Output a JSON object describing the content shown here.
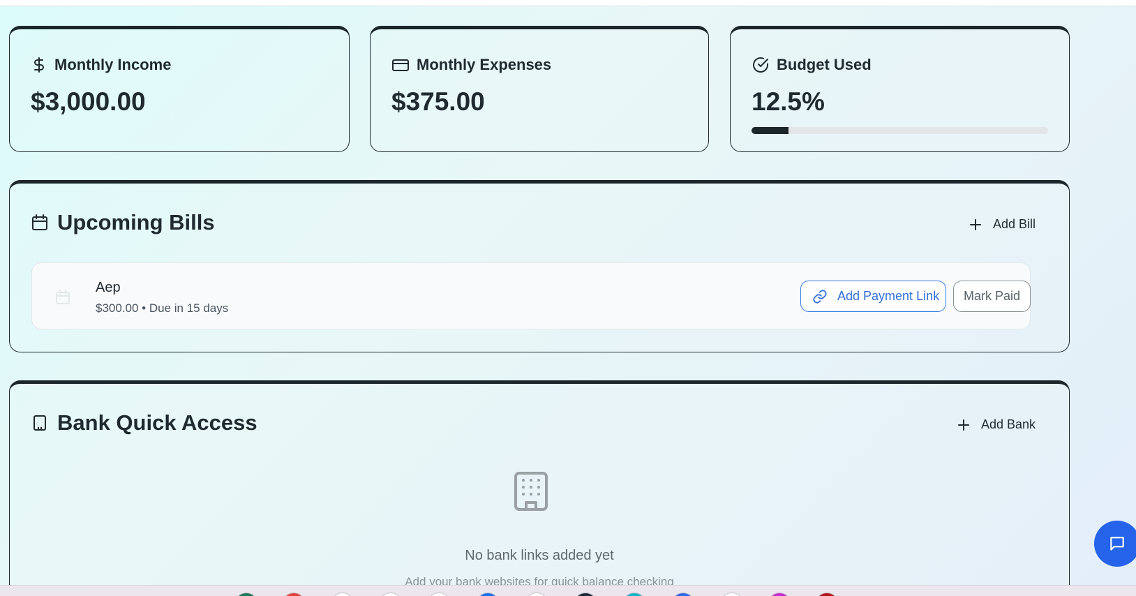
{
  "stats": {
    "income": {
      "label": "Monthly Income",
      "value": "$3,000.00",
      "icon": "dollar-icon"
    },
    "expenses": {
      "label": "Monthly Expenses",
      "value": "$375.00",
      "icon": "credit-card-icon"
    },
    "budget": {
      "label": "Budget Used",
      "value": "12.5%",
      "icon": "check-circle-icon",
      "progress_percent": 12.5
    }
  },
  "bills": {
    "title": "Upcoming Bills",
    "add_label": "Add Bill",
    "items": [
      {
        "name": "Aep",
        "meta": "$300.00 • Due in 15 days",
        "payment_link_label": "Add Payment Link",
        "mark_paid_label": "Mark Paid"
      }
    ]
  },
  "banks": {
    "title": "Bank Quick Access",
    "add_label": "Add Bank",
    "empty_title": "No bank links added yet",
    "empty_subtitle": "Add your bank websites for quick balance checking"
  },
  "colors": {
    "accent": "#2563eb",
    "link": "#2f6fd6",
    "text": "#1f2a30"
  },
  "taskbar": {
    "icons": [
      "#1f7a5a",
      "#e0433a",
      "#ffffff",
      "#ffffff",
      "#ffffff",
      "#1a73e8",
      "#ffffff",
      "#1d2a3a",
      "#16b5c9",
      "#2d6be4",
      "#ffffff",
      "#c62cd3",
      "#b3161b"
    ]
  }
}
